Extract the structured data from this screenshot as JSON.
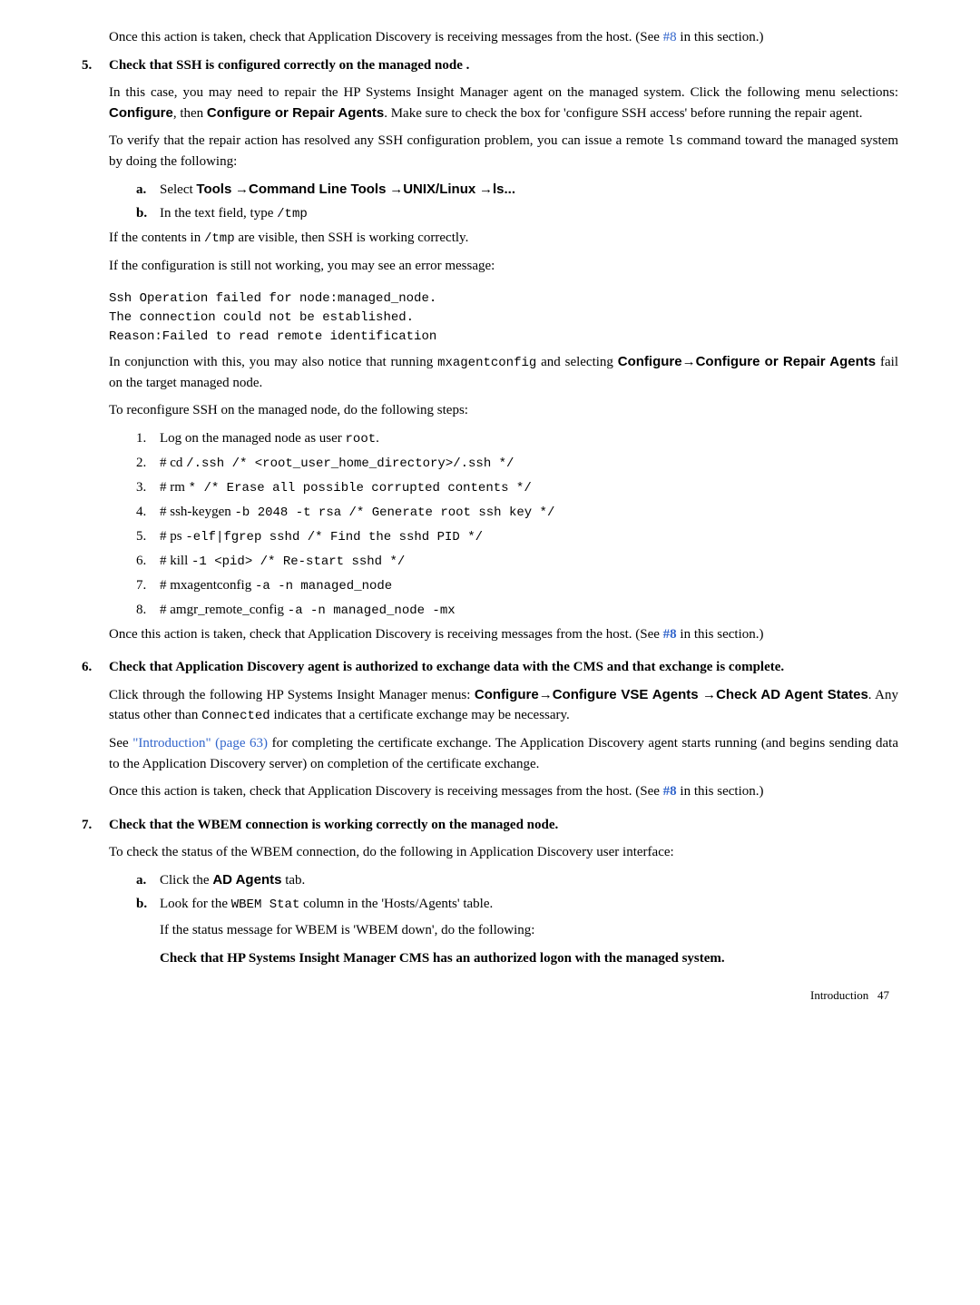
{
  "top": {
    "para1a": "Once this action is taken, check that Application Discovery is receiving messages from the host. (See ",
    "para1link": "#8",
    "para1b": " in this section.)"
  },
  "item5": {
    "num": "5.",
    "title": "Check that SSH is configured correctly on the managed node .",
    "p1a": "In this case, you may need to repair the HP Systems Insight Manager agent on the managed system. Click the following menu selections: ",
    "p1b": "Configure",
    "p1c": ", then ",
    "p1d": "Configure or Repair Agents",
    "p1e": ". Make sure to check the box for 'configure SSH access' before running the repair agent.",
    "p2a": "To verify that the repair action has resolved any SSH configuration problem, you can issue a remote ",
    "p2b": "ls",
    "p2c": " command toward the managed system by doing the following:",
    "sub_a_letter": "a.",
    "sub_a_1": "Select ",
    "sub_a_2": "Tools",
    "sub_a_3": " →",
    "sub_a_4": "Command Line Tools",
    "sub_a_5": " →",
    "sub_a_6": "UNIX/Linux",
    "sub_a_7": " →",
    "sub_a_8": "ls...",
    "sub_b_letter": "b.",
    "sub_b_1": "In the text field, type ",
    "sub_b_2": "/tmp",
    "p3a": "If the contents in ",
    "p3b": "/tmp",
    "p3c": " are visible, then SSH is working correctly.",
    "p4": "If the configuration is still not working, you may see an error message:",
    "code1": "Ssh Operation failed for node:managed_node.\nThe connection could not be established.\nReason:Failed to read remote identification",
    "p5a": "In conjunction with this, you may also notice that running ",
    "p5b": "mxagentconfig",
    "p5c": " and selecting ",
    "p5d": "Configure",
    "p5e": "→",
    "p5f": "Configure or Repair Agents",
    "p5g": " fail on the target managed node.",
    "p6": "To reconfigure SSH on the managed node, do the following steps:",
    "steps": [
      {
        "n": "1.",
        "a": "Log on the managed node as user ",
        "b": "root",
        "c": "."
      },
      {
        "n": "2.",
        "a": "# cd ",
        "b": "/.ssh /* <root_user_home_directory>/.ssh */"
      },
      {
        "n": "3.",
        "a": "# rm ",
        "b": "* /* Erase all possible corrupted contents */"
      },
      {
        "n": "4.",
        "a": "# ssh-keygen ",
        "b": "-b 2048 -t rsa /* Generate root ssh key */"
      },
      {
        "n": "5.",
        "a": "# ps ",
        "b": "-elf|fgrep sshd /* Find the sshd PID */"
      },
      {
        "n": "6.",
        "a": "# kill ",
        "b": "-1 <pid> /* Re-start sshd */"
      },
      {
        "n": "7.",
        "a": "# mxagentconfig ",
        "b": "-a -n managed_node"
      },
      {
        "n": "8.",
        "a": "# amgr_remote_config ",
        "b": "-a -n managed_node -mx"
      }
    ],
    "p7a": "Once this action is taken, check that Application Discovery is receiving messages from the host. (See ",
    "p7link": "#8",
    "p7b": " in this section.)"
  },
  "item6": {
    "num": "6.",
    "title": "Check that Application Discovery agent is authorized to exchange data with the CMS and that exchange is complete.",
    "p1a": "Click through the following HP Systems Insight Manager menus: ",
    "p1b": "Configure",
    "p1c": "→",
    "p1d": "Configure VSE Agents",
    "p1e": " →",
    "p1f": "Check AD Agent States",
    "p1g": ". Any status other than ",
    "p1h": "Connected",
    "p1i": " indicates that a certificate exchange may be necessary.",
    "p2a": "See ",
    "p2link": "\"Introduction\" (page 63)",
    "p2b": " for completing the certificate exchange. The Application Discovery agent starts running (and begins sending data to the Application Discovery server) on completion of the certificate exchange.",
    "p3a": "Once this action is taken, check that Application Discovery is receiving messages from the host. (See ",
    "p3link": "#8",
    "p3b": " in this section.)"
  },
  "item7": {
    "num": "7.",
    "title": "Check that the WBEM connection is working correctly on the managed node.",
    "p1": "To check the status of the WBEM connection, do the following in Application Discovery user interface:",
    "sub_a_letter": "a.",
    "sub_a_1": "Click the ",
    "sub_a_2": "AD Agents",
    "sub_a_3": " tab.",
    "sub_b_letter": "b.",
    "sub_b_1": "Look for the ",
    "sub_b_2": "WBEM Stat",
    "sub_b_3": " column in the 'Hosts/Agents' table.",
    "sub_b_p2": "If the status message for WBEM is 'WBEM down', do the following:",
    "sub_b_p3": "Check that HP Systems Insight Manager CMS has an authorized logon with the managed system."
  },
  "footer": {
    "label": "Introduction",
    "page": "47"
  }
}
